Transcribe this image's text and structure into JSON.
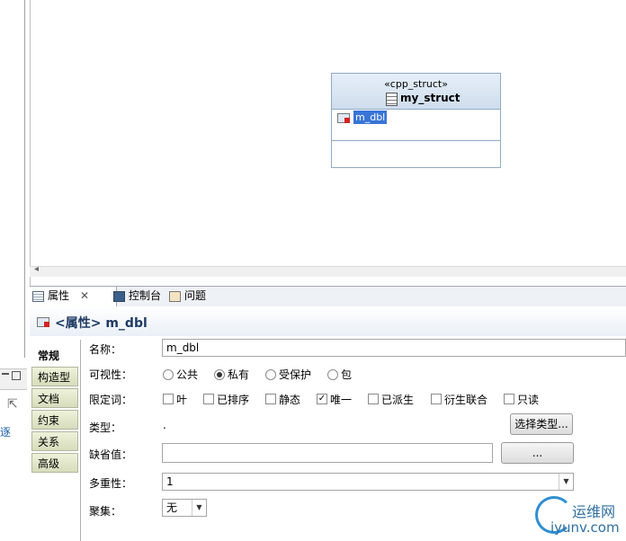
{
  "left_panel": {
    "link_text": "逐"
  },
  "diagram": {
    "stereotype": "«cpp_struct»",
    "struct_name": "my_struct",
    "attribute": "m_dbl"
  },
  "tabs": [
    {
      "label": "属性",
      "close": "✕"
    },
    {
      "label": "控制台"
    },
    {
      "label": "问题"
    }
  ],
  "properties": {
    "title": "<属性> m_dbl",
    "categories": [
      "常规",
      "构造型",
      "文档",
      "约束",
      "关系",
      "高级"
    ],
    "name_label": "名称：",
    "name_value": "m_dbl",
    "visibility_label": "可视性：",
    "visibility_options": [
      "公共",
      "私有",
      "受保护",
      "包"
    ],
    "qualifier_label": "限定词：",
    "qualifier_options": [
      "叶",
      "已排序",
      "静态",
      "唯一",
      "已派生",
      "衍生联合",
      "只读"
    ],
    "type_label": "类型：",
    "type_value": ".",
    "select_type_button": "选择类型...",
    "default_label": "缺省值：",
    "default_button": "...",
    "multiplicity_label": "多重性：",
    "multiplicity_value": "1",
    "aggregation_label": "聚集：",
    "aggregation_value": "无"
  },
  "watermark": {
    "cn": "运维网",
    "en": "iyunv.com"
  }
}
